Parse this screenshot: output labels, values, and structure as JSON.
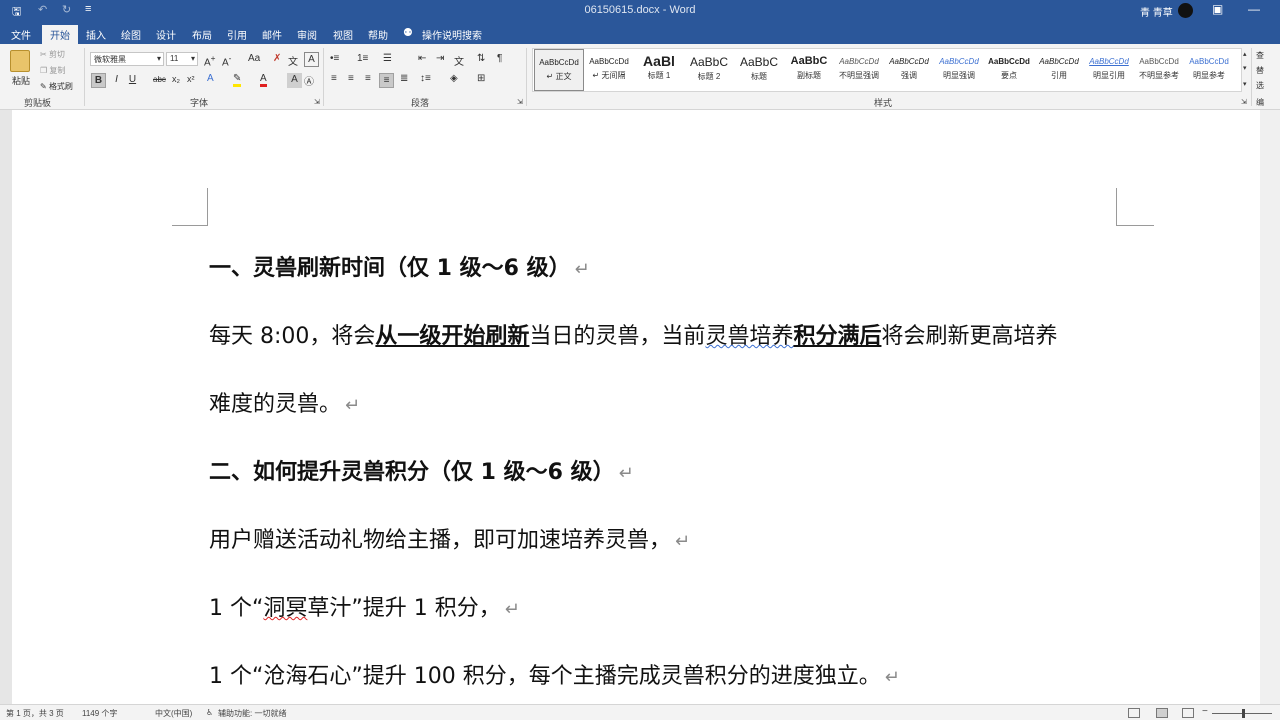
{
  "titlebar": {
    "save_icon": "save-icon",
    "undo_icon": "undo-icon",
    "redo_icon": "redo-icon",
    "title": "06150615.docx  -  Word",
    "user": "青 青草",
    "restore_icon": "ribbon-display-icon",
    "minimize_icon": "minimize-icon"
  },
  "tabs": [
    "文件",
    "开始",
    "插入",
    "绘图",
    "设计",
    "布局",
    "引用",
    "邮件",
    "审阅",
    "视图",
    "帮助"
  ],
  "active_tab": "开始",
  "tell_me": "操作说明搜索",
  "ribbon": {
    "clipboard": {
      "paste": "粘贴",
      "cut": "剪切",
      "copy": "复制",
      "format_painter": "格式刷",
      "label": "剪贴板"
    },
    "font": {
      "name": "微软雅黑",
      "size": "11",
      "label": "字体",
      "buttons": [
        "B",
        "I",
        "U",
        "abc",
        "x₂",
        "x²"
      ]
    },
    "paragraph": {
      "label": "段落"
    },
    "styles": {
      "label": "样式",
      "items": [
        {
          "preview": "AaBbCcDd",
          "name": "↵ 正文"
        },
        {
          "preview": "AaBbCcDd",
          "name": "↵ 无间隔"
        },
        {
          "preview": "AaBl",
          "name": "标题 1"
        },
        {
          "preview": "AaBbC",
          "name": "标题 2"
        },
        {
          "preview": "AaBbC",
          "name": "标题"
        },
        {
          "preview": "AaBbC",
          "name": "副标题"
        },
        {
          "preview": "AaBbCcDd",
          "name": "不明显强调"
        },
        {
          "preview": "AaBbCcDd",
          "name": "强调"
        },
        {
          "preview": "AaBbCcDd",
          "name": "明显强调"
        },
        {
          "preview": "AaBbCcDd",
          "name": "要点"
        },
        {
          "preview": "AaBbCcDd",
          "name": "引用"
        },
        {
          "preview": "AaBbCcDd",
          "name": "明显引用"
        },
        {
          "preview": "AaBbCcDd",
          "name": "不明显参考"
        },
        {
          "preview": "AaBbCcDd",
          "name": "明显参考"
        }
      ],
      "selected": "↵ 正文"
    },
    "editing_cut": [
      "查",
      "替",
      "选",
      "编"
    ]
  },
  "document": {
    "heading1": "一、灵兽刷新时间（仅 1 级～6 级）",
    "p1_a": "每天 8:00，将会",
    "p1_b": "从一级开始刷新",
    "p1_c": "当日的灵兽，当前",
    "p1_d": "灵兽培养",
    "p1_e": "积分满后",
    "p1_f": "将会刷新更高培养",
    "p2": "难度的灵兽。",
    "heading2": "二、如何提升灵兽积分（仅 1 级～6 级）",
    "p3": "用户赠送活动礼物给主播，即可加速培养灵兽，",
    "p4_a": "1 个“",
    "p4_b": "洞冥",
    "p4_c": "草汁”提升 1 积分，",
    "p5": "1 个“沧海石心”提升 100 积分，每个主播完成灵兽积分的进度独立。",
    "para_mark": "↵"
  },
  "statusbar": {
    "page": "第 1 页，共 3 页",
    "words": "1149 个字",
    "lang": "中文(中国)",
    "accessibility": "辅助功能: 一切就绪"
  },
  "colors": {
    "brand": "#2b579a",
    "ribbon": "#f3f3f3",
    "page": "#ffffff",
    "background": "#e6e6e6"
  }
}
